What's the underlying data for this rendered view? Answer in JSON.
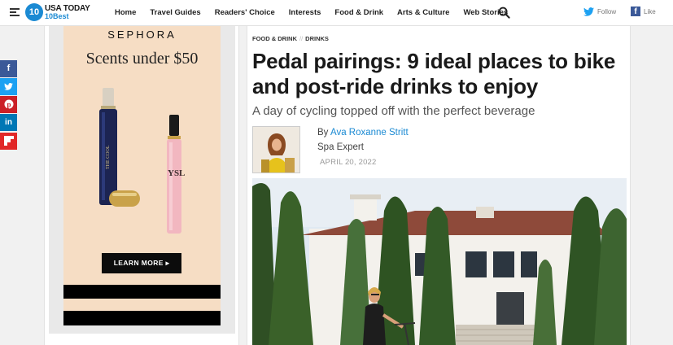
{
  "header": {
    "logo_num": "10",
    "logo_line1": "USA TODAY",
    "logo_line2": "10Best",
    "nav": [
      "Home",
      "Travel Guides",
      "Readers' Choice",
      "Interests",
      "Food & Drink",
      "Arts & Culture",
      "Web Stories"
    ],
    "twitter_label": "Follow",
    "facebook_label": "Like"
  },
  "ad": {
    "brand": "SEPHORA",
    "headline": "Scents under $50",
    "button": "LEARN MORE ▸"
  },
  "share": [
    {
      "icon": "facebook-icon",
      "glyph": "f",
      "color": "#3b5998"
    },
    {
      "icon": "twitter-icon",
      "glyph": "t",
      "color": "#1da1f2"
    },
    {
      "icon": "pinterest-icon",
      "glyph": "p",
      "color": "#cb2027"
    },
    {
      "icon": "linkedin-icon",
      "glyph": "in",
      "color": "#0077b5"
    },
    {
      "icon": "flipboard-icon",
      "glyph": "F",
      "color": "#e12828"
    }
  ],
  "article": {
    "breadcrumb": [
      "FOOD & DRINK",
      "DRINKS"
    ],
    "breadcrumb_sep": "//",
    "title": "Pedal pairings: 9 ideal places to bike and post-ride drinks to enjoy",
    "subtitle": "A day of cycling topped off with the perfect beverage",
    "by": "By",
    "author": "Ava Roxanne Stritt",
    "role": "Spa Expert",
    "date": "APRIL 20, 2022"
  },
  "colors": {
    "accent": "#1b8ad3",
    "ad_background": "#f6ddc4"
  }
}
